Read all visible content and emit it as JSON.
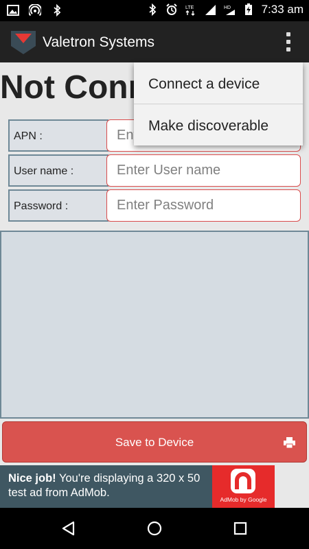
{
  "status_bar": {
    "time": "7:33 am",
    "left_icons": [
      "image-icon",
      "hotspot-icon",
      "bluetooth-icon"
    ],
    "right_icons": [
      "bluetooth-icon",
      "alarm-icon",
      "lte-icon",
      "signal-icon",
      "hd-icon",
      "signal-icon",
      "battery-charging-icon"
    ],
    "lte_label": "LTE",
    "hd_label": "HD"
  },
  "app_bar": {
    "title": "Valetron Systems",
    "logo": "valetron-logo",
    "overflow": "overflow-menu-icon"
  },
  "connection_status": "Not Connected",
  "form": {
    "apn": {
      "label": "APN :",
      "placeholder": "Enter APN"
    },
    "username": {
      "label": "User name :",
      "placeholder": "Enter User name"
    },
    "password": {
      "label": "Password :",
      "placeholder": "Enter Password"
    }
  },
  "save_button": {
    "label": "Save to Device",
    "icon": "printer-icon"
  },
  "ad": {
    "headline": "Nice job!",
    "body": " You're displaying a 320 x 50 test ad from AdMob.",
    "logo_text": "AdMob by Google"
  },
  "menu": {
    "items": [
      {
        "label": "Connect a device"
      },
      {
        "label": "Make discoverable"
      }
    ]
  },
  "nav_bar": [
    "back-icon",
    "home-icon",
    "recents-icon"
  ],
  "colors": {
    "app_bar": "#222222",
    "button": "#d9534f",
    "input_border": "#d94b4b",
    "label_bg": "#dde1e6",
    "ad_bg": "#3f5762",
    "ad_logo": "#e62b2b"
  }
}
